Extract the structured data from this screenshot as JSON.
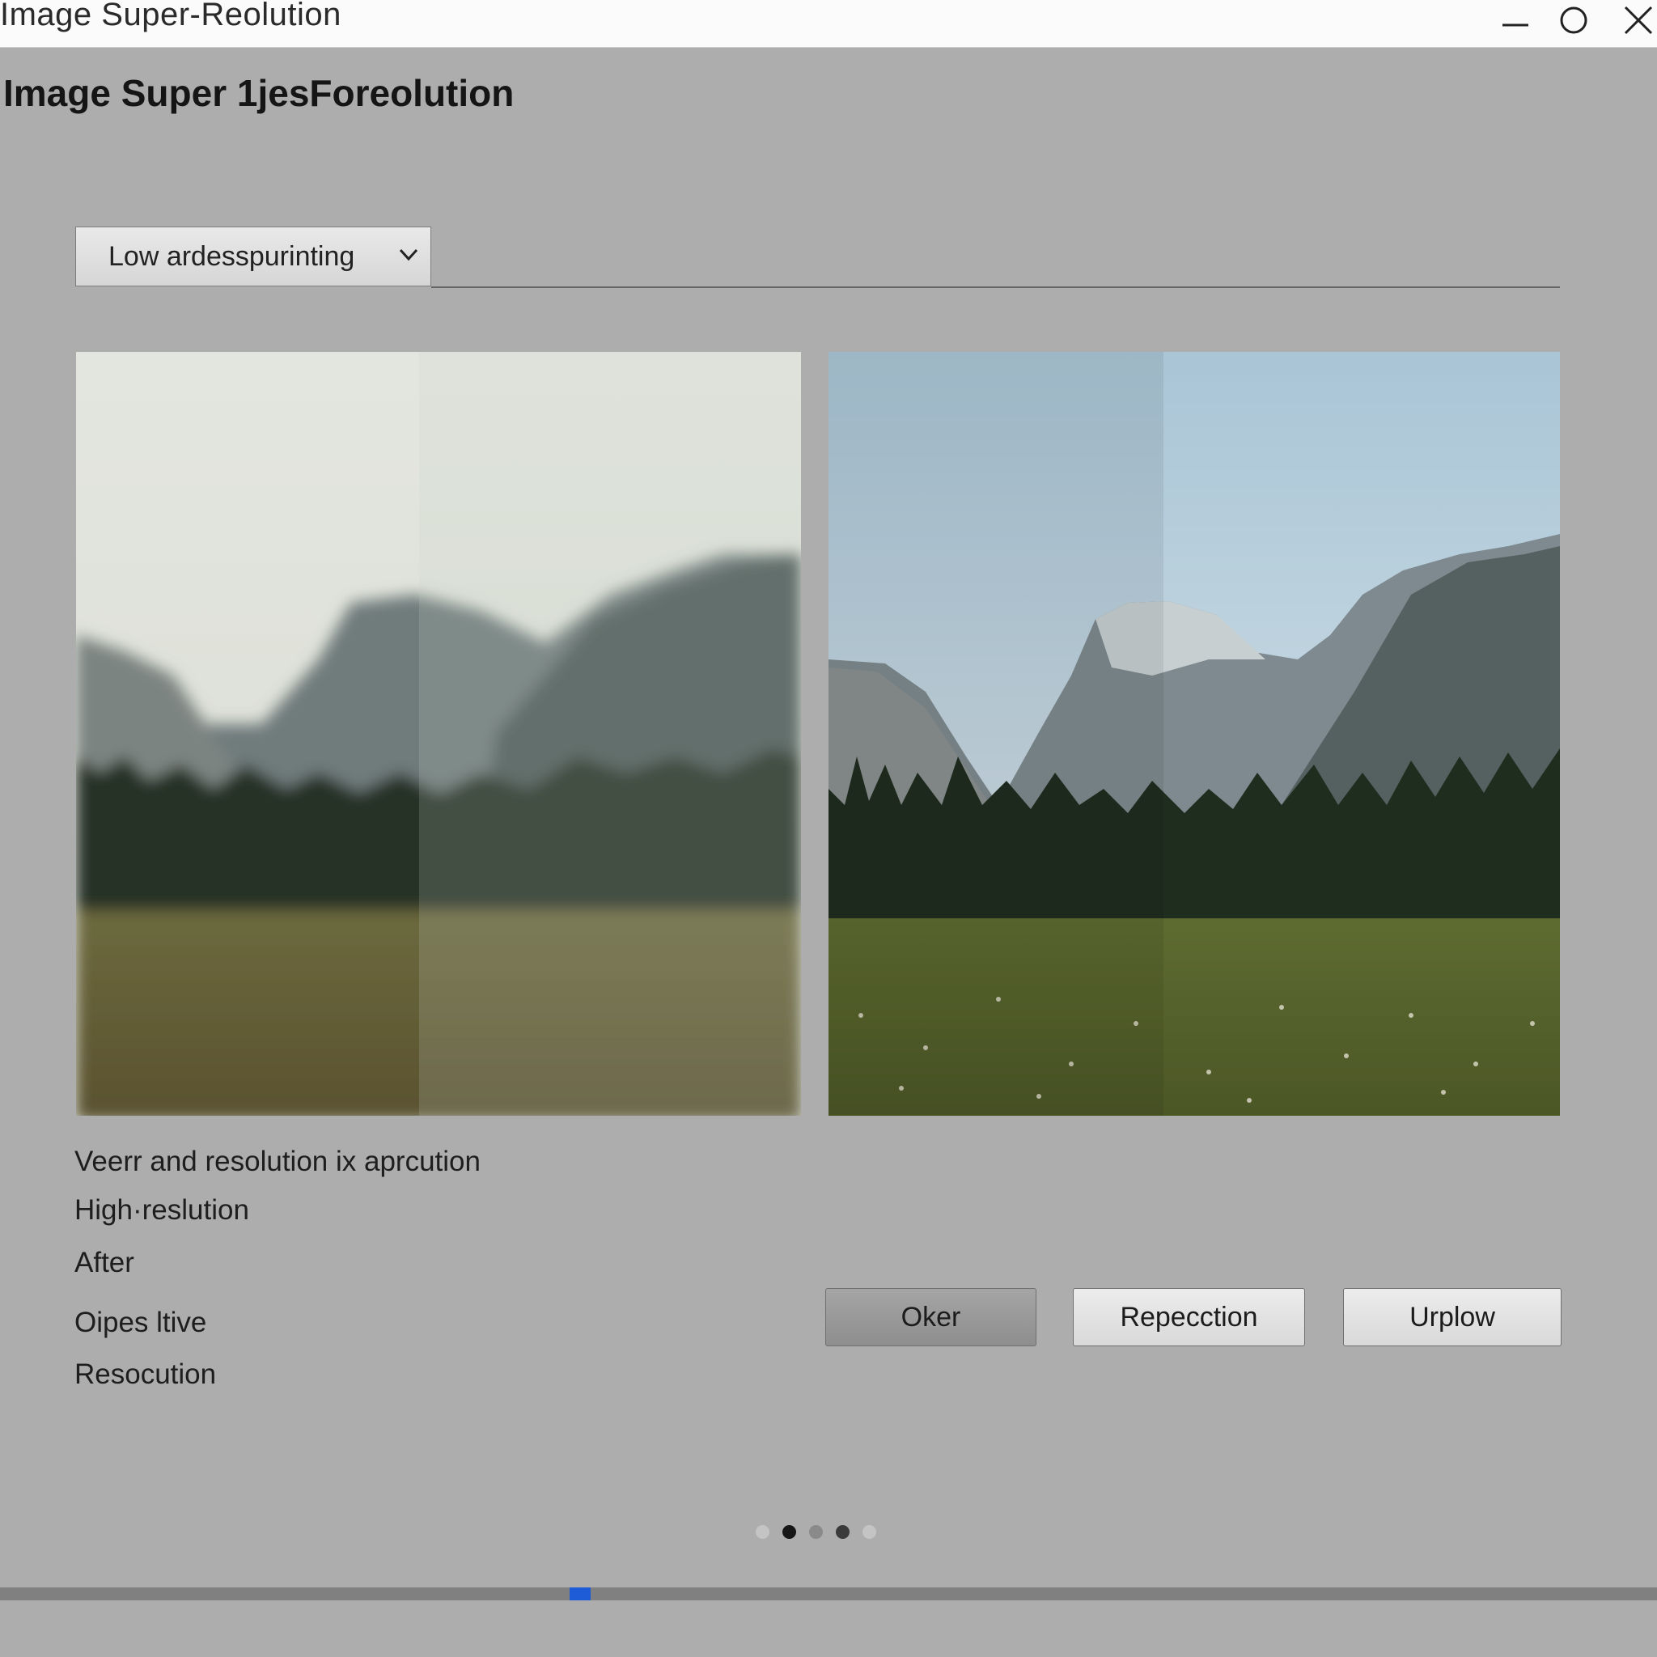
{
  "window": {
    "title": "Image Super-Reolution",
    "controls": [
      {
        "name": "minimize-icon"
      },
      {
        "name": "maximize-icon"
      },
      {
        "name": "close-icon"
      }
    ]
  },
  "main": {
    "heading": "Image Super 1jesForeolution",
    "dropdown": {
      "selected": "Low ardesspurinting",
      "icon": "chevron-down-icon"
    },
    "panels": {
      "before": {
        "style": "blurred-landscape"
      },
      "after": {
        "style": "sharp-landscape"
      }
    },
    "descriptions": [
      "Veerr and resolution ix aprcution",
      "High·reslution",
      "After",
      "Oipes ltive",
      "Resocution"
    ],
    "buttons": [
      {
        "label": "Oker"
      },
      {
        "label": "Repecction"
      },
      {
        "label": "Urplow"
      }
    ]
  },
  "pager": {
    "count": 5,
    "active": [
      1,
      3
    ]
  },
  "progress": {
    "position": 0.35
  },
  "colors": {
    "accent": "#1e5bd6",
    "background": "#adadad",
    "titlebar": "#fbfbfb"
  }
}
